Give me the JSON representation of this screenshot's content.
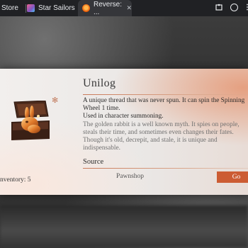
{
  "browser": {
    "tabs": [
      {
        "label": "Store"
      },
      {
        "label": "Star Sailors"
      },
      {
        "label": "Reverse: ...",
        "close": "✕"
      }
    ],
    "icons": [
      "puzzle-icon",
      "profile-icon",
      "more-icon"
    ]
  },
  "item": {
    "title": "Unilog",
    "description_main": "A unique thread that was never spun. It can spin the Spinning Wheel 1 time.",
    "usage": "Used in character summoning.",
    "lore": "The golden rabbit is a well known myth. It spies on people, steals their time, and sometimes even changes their fates. Though it's old, decrepit, and stale, it is unique and indispensable.",
    "inventory": "nventory: 5",
    "source_heading": "Source",
    "source_name": "Pawnshop",
    "go_label": "Go"
  },
  "colors": {
    "accent": "#cc5c33",
    "title_rule": "#c97a5a"
  }
}
